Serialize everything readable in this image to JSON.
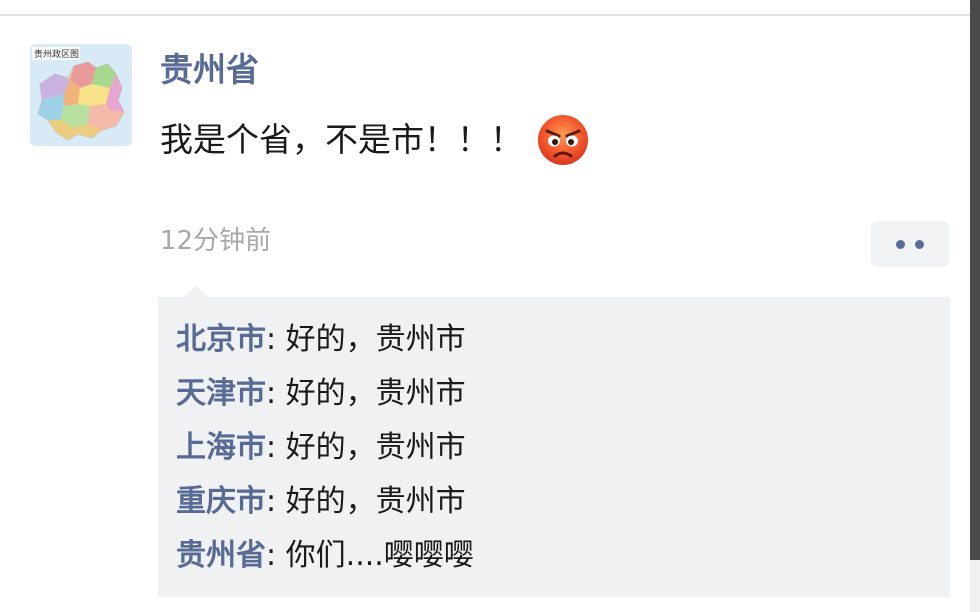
{
  "post": {
    "author": "贵州省",
    "avatar_label": "贵州政区图",
    "text": "我是个省，不是市！！！",
    "emoji": "angry-face-emoji",
    "time": "12分钟前"
  },
  "comments": [
    {
      "author": "北京市",
      "sep": ": ",
      "text": "好的，贵州市"
    },
    {
      "author": "天津市",
      "sep": ": ",
      "text": "好的，贵州市"
    },
    {
      "author": "上海市",
      "sep": ": ",
      "text": "好的，贵州市"
    },
    {
      "author": "重庆市",
      "sep": ": ",
      "text": "好的，贵州市"
    },
    {
      "author": "贵州省",
      "sep": ": ",
      "text": "你们....嘤嘤嘤"
    }
  ],
  "colors": {
    "name_link": "#576b95",
    "comment_bg": "#f0f1f2",
    "time_gray": "#a8a8a8"
  },
  "icons": {
    "more": "more-dots-icon"
  }
}
